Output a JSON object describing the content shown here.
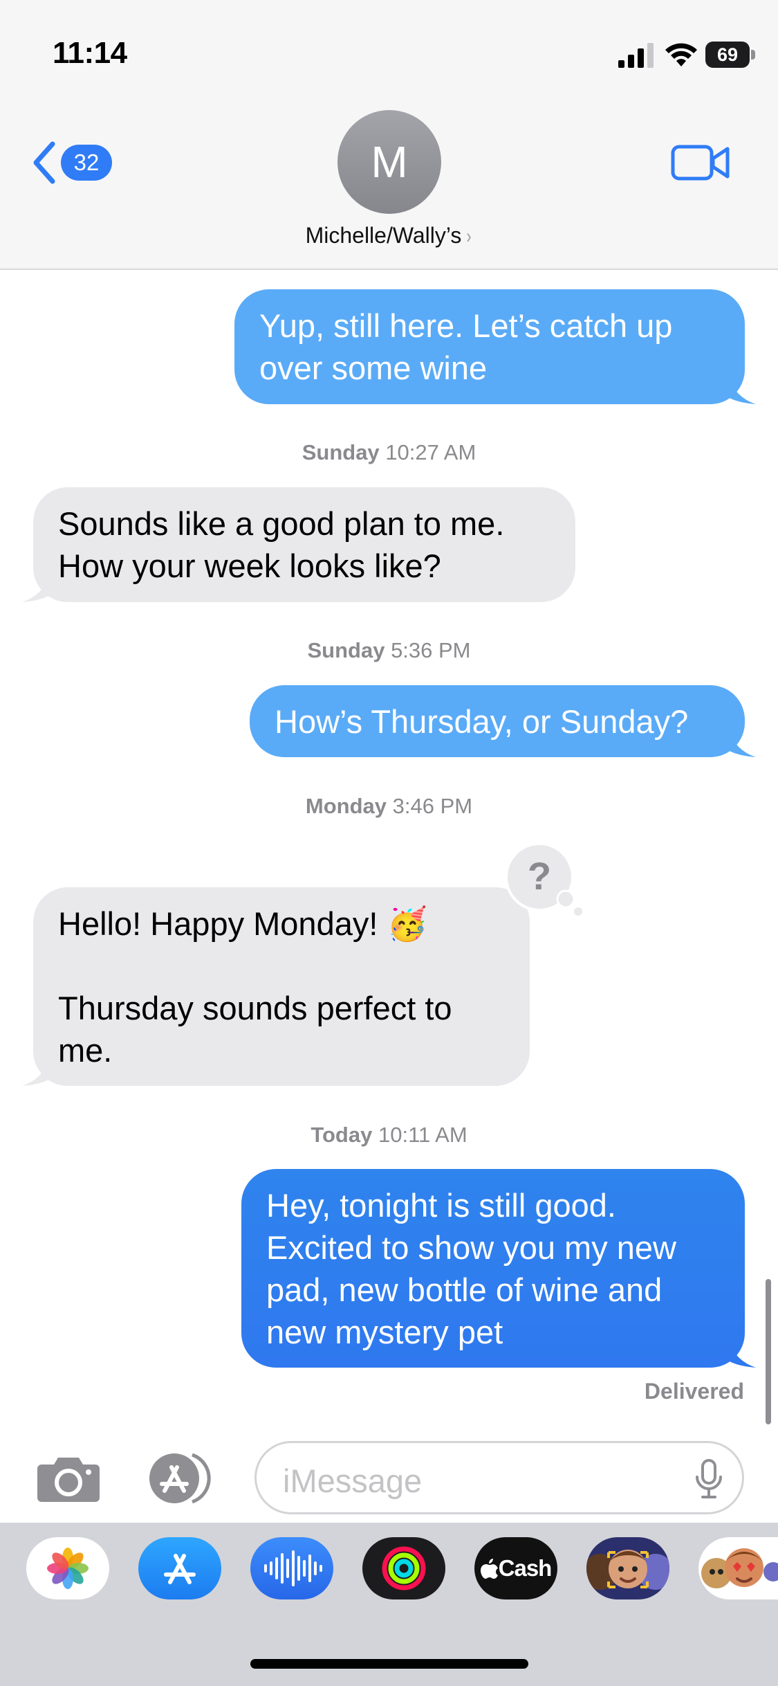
{
  "status_bar": {
    "time": "11:14",
    "battery_percent": "69",
    "signal_bars": 3,
    "wifi": "wifi-icon"
  },
  "header": {
    "back_badge_count": "32",
    "avatar_initial": "M",
    "contact_name": "Michelle/Wally’s",
    "contact_chevron": "›"
  },
  "thread": {
    "messages": [
      {
        "direction": "sent",
        "text": "Yup, still here. Let’s catch up over some wine"
      },
      {
        "timestamp_day": "Sunday",
        "timestamp_time": "10:27 AM"
      },
      {
        "direction": "received",
        "text": "Sounds like a good plan to me. How your week looks like?"
      },
      {
        "timestamp_day": "Sunday",
        "timestamp_time": "5:36 PM"
      },
      {
        "direction": "sent",
        "text": "How’s Thursday, or Sunday?"
      },
      {
        "timestamp_day": "Monday",
        "timestamp_time": "3:46 PM"
      },
      {
        "direction": "received",
        "text_line1": "Hello! Happy Monday! 🥳",
        "text_line2": "Thursday sounds perfect to me.",
        "tapback": "?"
      },
      {
        "timestamp_day": "Today",
        "timestamp_time": "10:11 AM"
      },
      {
        "direction": "sent",
        "text": "Hey, tonight is still good. Excited to show you my new pad, new bottle of wine and new mystery pet",
        "status": "Delivered"
      }
    ]
  },
  "input_bar": {
    "placeholder": "iMessage"
  },
  "app_drawer": {
    "apps": [
      {
        "name": "photos-icon"
      },
      {
        "name": "app-store-icon"
      },
      {
        "name": "audio-message-icon"
      },
      {
        "name": "fitness-activity-icon"
      },
      {
        "name": "apple-cash-icon",
        "label": "Cash"
      },
      {
        "name": "memoji-icon"
      },
      {
        "name": "memoji-stickers-icon"
      }
    ]
  },
  "colors": {
    "accent_blue": "#2f7cf6",
    "sent_bubble_blue": "#5aabf7",
    "received_bubble_gray": "#e9e9eb",
    "timestamp_gray": "#8a8a8e"
  }
}
